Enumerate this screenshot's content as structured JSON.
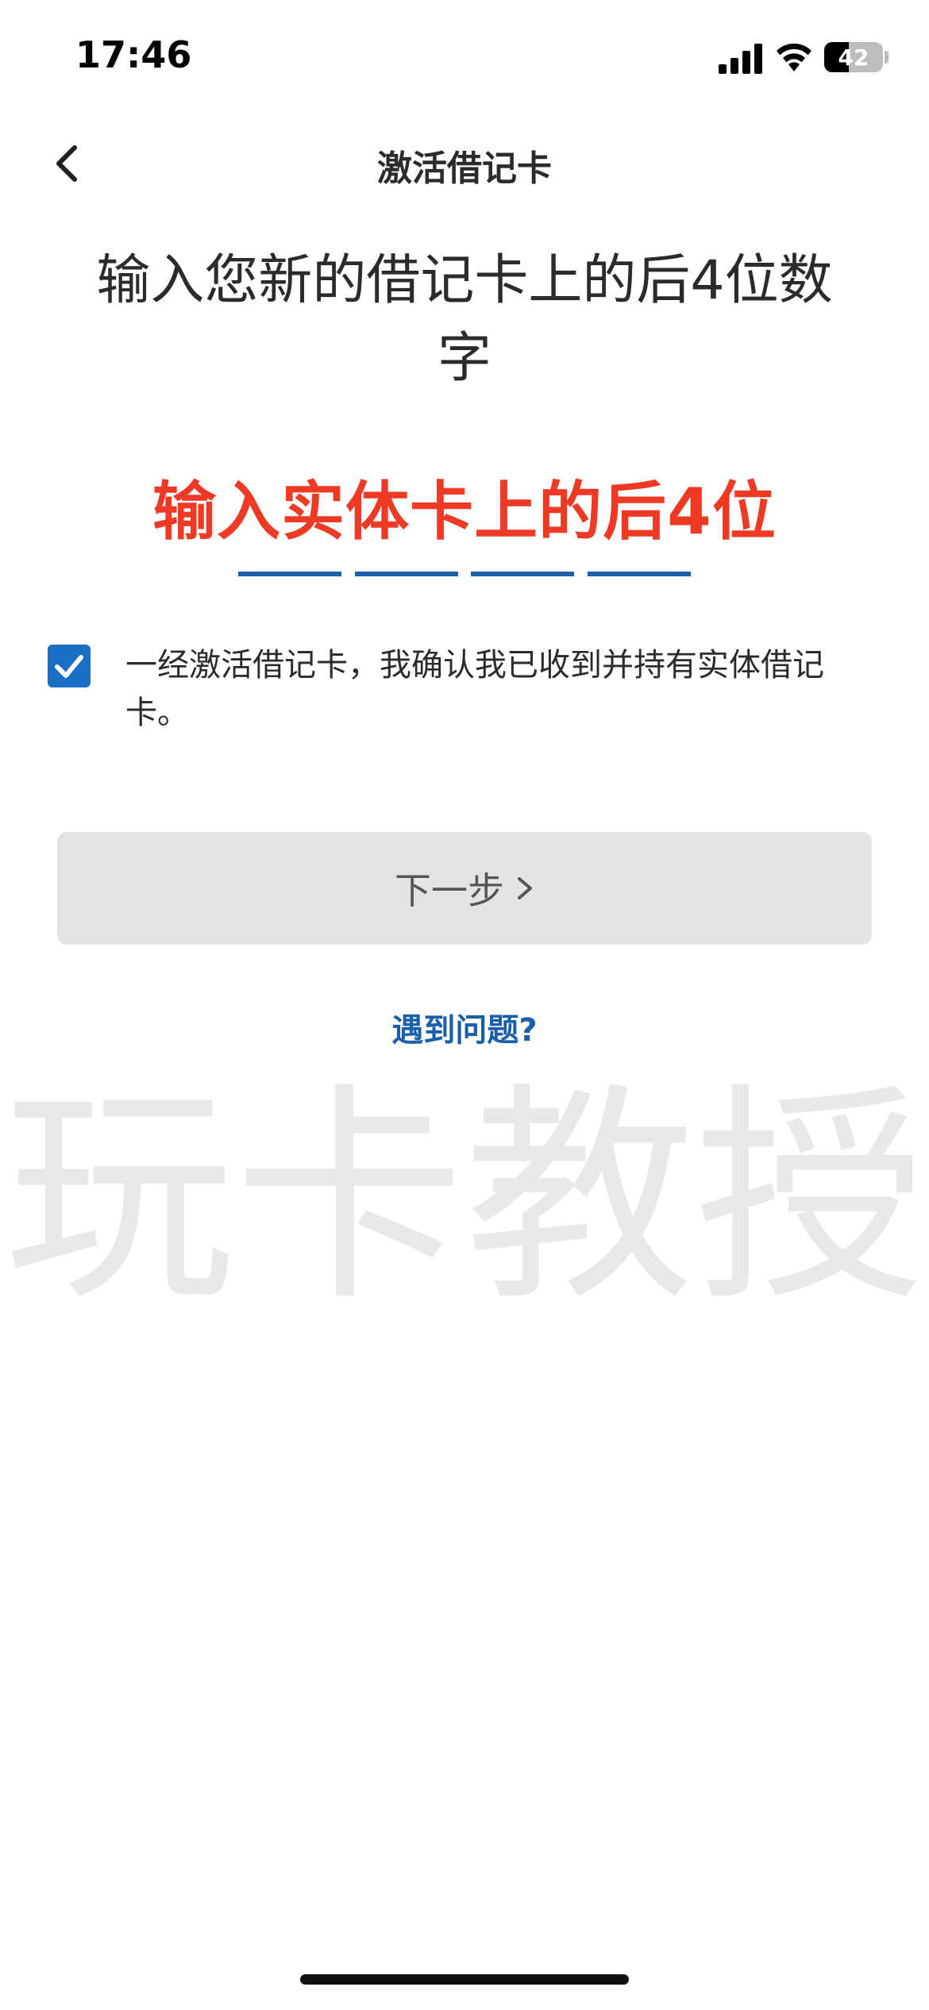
{
  "status_bar": {
    "time": "17:46",
    "battery_level": "42",
    "battery_fraction": 0.42
  },
  "nav": {
    "title": "激活借记卡",
    "back_icon": "chevron-left-icon"
  },
  "instruction": "输入您新的借记卡上的后4位数字",
  "overlay_annotation": "输入实体卡上的后4位",
  "digit_inputs": {
    "count": 4,
    "values": [
      "",
      "",
      "",
      ""
    ],
    "color": "#1a5fa8"
  },
  "consent": {
    "checked": true,
    "text": "一经激活借记卡，我确认我已收到并持有实体借记卡。",
    "checkbox_color": "#1a6fc4"
  },
  "next_button": {
    "label": "下一步",
    "chevron_icon": "chevron-right-icon",
    "disabled": true
  },
  "help_link": "遇到问题?",
  "watermark": "玩卡教授"
}
